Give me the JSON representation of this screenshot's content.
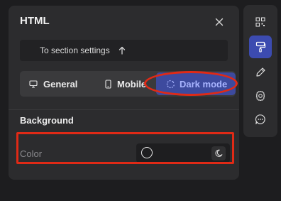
{
  "panel": {
    "title": "HTML",
    "section_link_label": "To section settings"
  },
  "tabs": [
    {
      "label": "General",
      "icon": "monitor-icon",
      "active": false
    },
    {
      "label": "Mobile",
      "icon": "mobile-icon",
      "active": false
    },
    {
      "label": "Dark mode",
      "icon": "dark-mode-icon",
      "active": true
    }
  ],
  "background": {
    "heading": "Background",
    "color_label": "Color"
  },
  "toolbar": [
    {
      "icon": "qr-code-icon",
      "active": false
    },
    {
      "icon": "paint-roller-icon",
      "active": true
    },
    {
      "icon": "pencil-icon",
      "active": false
    },
    {
      "icon": "settings-gear-icon",
      "active": false
    },
    {
      "icon": "chat-bubble-icon",
      "active": false
    }
  ],
  "colors": {
    "accent": "#3c4bb0",
    "accent_text": "#a8b4ff",
    "highlight": "#e02a16",
    "panel": "#2c2c2e",
    "page": "#1d1d1f"
  }
}
